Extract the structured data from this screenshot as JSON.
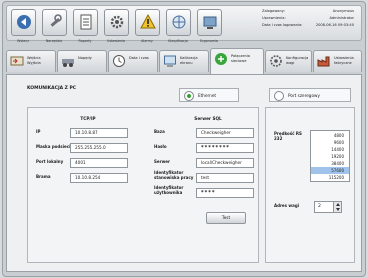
{
  "toolbar": {
    "buttons": [
      {
        "label": "Wstecz",
        "icon": "back-icon"
      },
      {
        "label": "Narzędzia",
        "icon": "tools-icon"
      },
      {
        "label": "Raporty",
        "icon": "reports-icon"
      },
      {
        "label": "Ustawienia",
        "icon": "settings-icon"
      },
      {
        "label": "Alarmy",
        "icon": "alarm-icon"
      },
      {
        "label": "Klasyfikacja",
        "icon": "classification-icon"
      },
      {
        "label": "Ergonomia",
        "icon": "ergonomics-icon"
      }
    ]
  },
  "info": {
    "rows": [
      {
        "key": "Zalogowany:",
        "value": "Anonymous"
      },
      {
        "key": "Uprawnienia:",
        "value": "Administrator"
      },
      {
        "key": "Data i czas logowania:",
        "value": "2008-06-16 09:03:40"
      }
    ]
  },
  "tabs": [
    {
      "label": "Wejścia Wyjścia",
      "icon": "io-icon"
    },
    {
      "label": "Napędy",
      "icon": "drives-icon"
    },
    {
      "label": "Data i czas",
      "icon": "clock-icon"
    },
    {
      "label": "Kalibracja ekranu",
      "icon": "calibration-icon"
    },
    {
      "label": "Połączenia sieciowe",
      "icon": "network-icon"
    },
    {
      "label": "Konfiguracja wagi",
      "icon": "scale-config-icon"
    },
    {
      "label": "Ustawienia fabryczne",
      "icon": "factory-icon"
    }
  ],
  "panel": {
    "title": "KOMUNIKACJA Z PC",
    "ethernet_label": "Ethernet",
    "serial_label": "Port szeregowy",
    "tcpip": {
      "header": "TCP/IP",
      "fields": [
        {
          "label": "IP",
          "value": "10.10.8.87"
        },
        {
          "label": "Maska podsieci",
          "value": "255.255.255.0"
        },
        {
          "label": "Port lokalny",
          "value": "4001"
        },
        {
          "label": "Brama",
          "value": "10.10.8.254"
        }
      ]
    },
    "sql": {
      "header": "Serwer SQL",
      "fields": [
        {
          "label": "Baza",
          "value": "Checkweigher"
        },
        {
          "label": "Hasło",
          "value": "********"
        },
        {
          "label": "Serwer",
          "value": "local\\Checkweigher"
        },
        {
          "label": "Identyfikator stanowiska pracy",
          "value": "test"
        },
        {
          "label": "Identyfikator użytkownika",
          "value": "****"
        }
      ],
      "test_label": "Test"
    },
    "serial": {
      "speed_label": "Prędkość RS 232",
      "speeds": [
        "4800",
        "9600",
        "14400",
        "19200",
        "38400",
        "57600",
        "115200"
      ],
      "selected": "57600",
      "address_label": "Adres wagi",
      "address_value": "2"
    }
  }
}
